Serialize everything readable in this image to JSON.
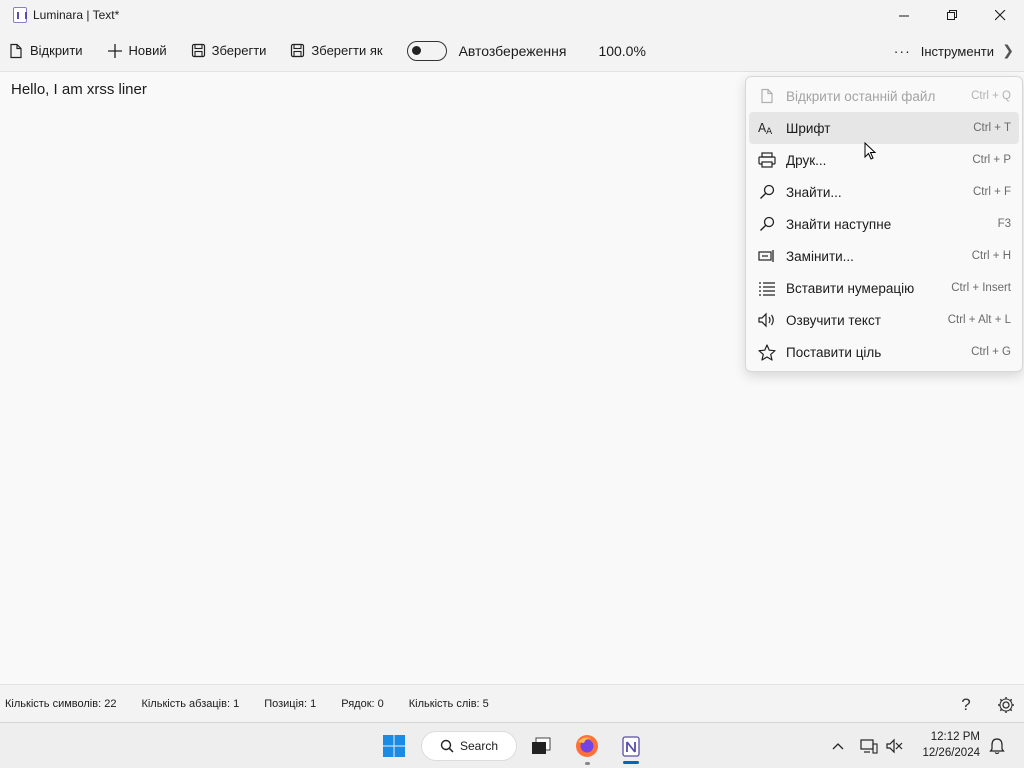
{
  "window": {
    "title": "Luminara | Text*"
  },
  "toolbar": {
    "open": "Відкрити",
    "new": "Новий",
    "save": "Зберегти",
    "save_as": "Зберегти як",
    "autosave_label": "Автозбереження",
    "autosave_on": false,
    "zoom": "100.0%",
    "tools": "Інструменти"
  },
  "editor": {
    "text": "Hello, I am xrss liner"
  },
  "menu": {
    "items": [
      {
        "label": "Відкрити останній файл",
        "shortcut": "Ctrl + Q",
        "icon": "file-recent-icon",
        "enabled": false
      },
      {
        "label": "Шрифт",
        "shortcut": "Ctrl + T",
        "icon": "font-icon",
        "enabled": true,
        "hovered": true
      },
      {
        "label": "Друк...",
        "shortcut": "Ctrl + P",
        "icon": "printer-icon",
        "enabled": true
      },
      {
        "label": "Знайти...",
        "shortcut": "Ctrl + F",
        "icon": "search-icon",
        "enabled": true
      },
      {
        "label": "Знайти наступне",
        "shortcut": "F3",
        "icon": "search-icon",
        "enabled": true
      },
      {
        "label": "Замінити...",
        "shortcut": "Ctrl + H",
        "icon": "replace-icon",
        "enabled": true
      },
      {
        "label": "Вставити нумерацію",
        "shortcut": "Ctrl + Insert",
        "icon": "list-icon",
        "enabled": true
      },
      {
        "label": "Озвучити текст",
        "shortcut": "Ctrl + Alt + L",
        "icon": "speaker-icon",
        "enabled": true
      },
      {
        "label": "Поставити ціль",
        "shortcut": "Ctrl + G",
        "icon": "star-icon",
        "enabled": true
      }
    ]
  },
  "status": {
    "chars": "Кількість символів: 22",
    "paragraphs": "Кількість абзаців: 1",
    "position": "Позиція: 1",
    "line": "Рядок: 0",
    "words": "Кількість слів: 5"
  },
  "taskbar": {
    "search": "Search",
    "time": "12:12 PM",
    "date": "12/26/2024"
  },
  "colors": {
    "accent": "#0067c0",
    "hover": "#e6e6e6"
  }
}
